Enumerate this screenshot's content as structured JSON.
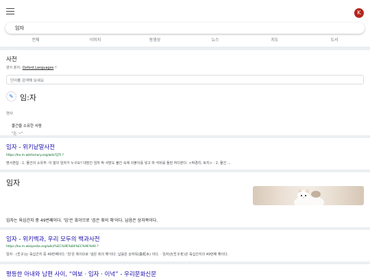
{
  "header": {
    "avatar_letter": "K",
    "query": "임자"
  },
  "tabs": [
    "전체",
    "이미지",
    "동영상",
    "뉴스",
    "지도",
    "도서"
  ],
  "dictionary": {
    "title": "사전",
    "source_prefix": "영어 출처:",
    "source_link": "Oxford Languages",
    "source_suffix": "?",
    "search_placeholder": "단어를 검색해 보세요",
    "word": "임:자",
    "part_of_speech": "명사",
    "definition": "물건을 소유한 사람",
    "example": "\"논 ~\""
  },
  "results": [
    {
      "title": "임자 - 위키낱말사전",
      "url": "https://ko.m.wiktionary.org/wiki/임자 ?",
      "snippet": "명사편집 · 1. 물건의 소유주. 이 말의 임자가 누구요? 대장간 임자 박 서방도 불간 속에 쇠붙이를 넣고 마 석비를 돌핀 처다본다. <박경리, 토지> · 2. 물건 ..."
    },
    {
      "title": "임자 - 위키백과, 우리 모두의 백과사전",
      "url": "https://ko.m.wikipedia.org/wiki/%EC%9E%84%EC%9E%90 ?",
      "snippet": "임자 · (壬子)는 육십간지 중 49번째이다. '임'은 흑이므로 '검은 쥐의 해'이다. 납음은 상자목(桑柘木) 이다. · 임자년(壬子年)은 육십간지의 49번째 해이다."
    },
    {
      "title": "평등한 아내와 남편 사이, “여보 · 임자 · 이녁” - 우리문화신문"
    }
  ],
  "knowledge_panel": {
    "title": "임자",
    "description": "임자는 육십간지 중 49번째이다. '임'은 흑이므로 '검은 쥐의 해'이다. 납음은 상자목이다."
  },
  "colors": {
    "link": "#1a0dab",
    "url": "#006621",
    "avatar": "#b3261e",
    "accent": "#1a73e8"
  },
  "icons": {
    "menu": "hamburger-menu-icon",
    "edit": "pencil-icon"
  }
}
